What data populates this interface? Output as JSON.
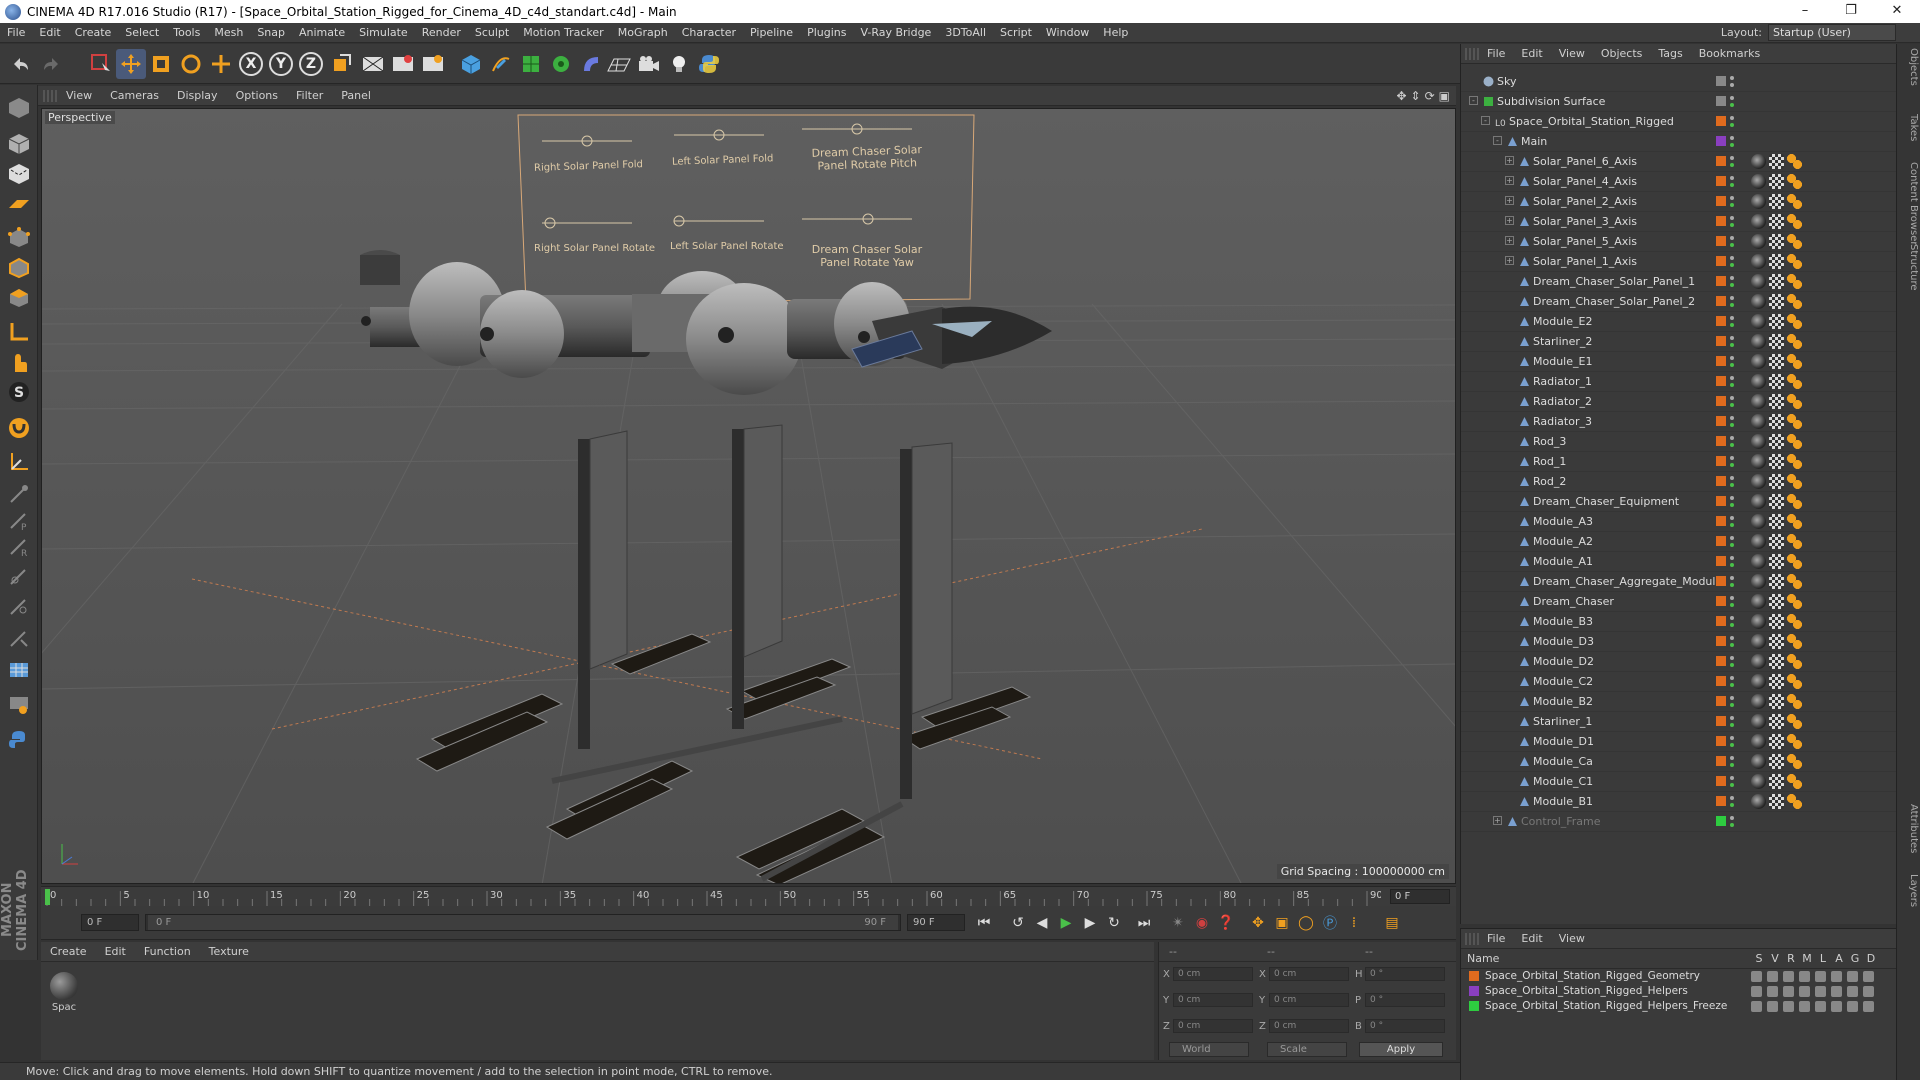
{
  "window": {
    "title": "CINEMA 4D R17.016 Studio (R17) - [Space_Orbital_Station_Rigged_for_Cinema_4D_c4d_standart.c4d] - Main",
    "controls": [
      "–",
      "❐",
      "✕"
    ]
  },
  "menu": {
    "items": [
      "File",
      "Edit",
      "Create",
      "Select",
      "Tools",
      "Mesh",
      "Snap",
      "Animate",
      "Simulate",
      "Render",
      "Sculpt",
      "Motion Tracker",
      "MoGraph",
      "Character",
      "Pipeline",
      "Plugins",
      "V-Ray Bridge",
      "3DToAll",
      "Script",
      "Window",
      "Help"
    ],
    "layout_label": "Layout:",
    "layout_value": "Startup (User)"
  },
  "toolbar": {
    "axis_x": "X",
    "axis_y": "Y",
    "axis_z": "Z",
    "icons": [
      "undo-icon",
      "redo-icon",
      "live-select-icon",
      "move-icon",
      "scale-icon",
      "rotate-icon",
      "move-multi-icon",
      "axis-x-icon",
      "axis-y-icon",
      "axis-z-icon",
      "coordinate-system-icon",
      "render-view-icon",
      "render-picture-viewer-icon",
      "render-settings-icon",
      "cube-icon",
      "pen-spline-icon",
      "subdivision-icon",
      "array-icon",
      "deformer-icon",
      "floor-icon",
      "camera-icon",
      "light-icon",
      "python-icon"
    ]
  },
  "viewport": {
    "menu": [
      "View",
      "Cameras",
      "Display",
      "Options",
      "Filter",
      "Panel"
    ],
    "label": "Perspective",
    "grid_spacing": "Grid Spacing : 100000000 cm",
    "rig_labels": [
      "Right Solar Panel Fold",
      "Left Solar Panel Fold",
      "Dream Chaser Solar Panel Rotate Pitch",
      "Right Solar Panel Rotate",
      "Left Solar Panel Rotate",
      "Dream Chaser Solar Panel Rotate Yaw"
    ]
  },
  "timeline": {
    "ticks": [
      "0",
      "5",
      "10",
      "15",
      "20",
      "25",
      "30",
      "35",
      "40",
      "45",
      "50",
      "55",
      "60",
      "65",
      "70",
      "75",
      "80",
      "85",
      "90"
    ],
    "current_frame": "0 F"
  },
  "transport": {
    "start_field": "0 F",
    "range_start": "0 F",
    "range_end": "90 F",
    "end_field": "90 F"
  },
  "materials": {
    "menu": [
      "Create",
      "Edit",
      "Function",
      "Texture"
    ],
    "items": [
      {
        "name": "Spac"
      }
    ]
  },
  "coordinates": {
    "headers": [
      "--",
      "--",
      "--"
    ],
    "rows": [
      {
        "a": "X",
        "av": "0 cm",
        "b": "X",
        "bv": "0 cm",
        "c": "H",
        "cv": "0 °"
      },
      {
        "a": "Y",
        "av": "0 cm",
        "b": "Y",
        "bv": "0 cm",
        "c": "P",
        "cv": "0 °"
      },
      {
        "a": "Z",
        "av": "0 cm",
        "b": "Z",
        "bv": "0 cm",
        "c": "B",
        "cv": "0 °"
      }
    ],
    "mode": "World",
    "transform": "Scale",
    "apply": "Apply"
  },
  "status": "Move: Click and drag to move elements. Hold down SHIFT to quantize movement / add to the selection in point mode, CTRL to remove.",
  "brand": "MAXON CINEMA 4D",
  "object_manager": {
    "menu": [
      "File",
      "Edit",
      "View",
      "Objects",
      "Tags",
      "Bookmarks"
    ],
    "rows": [
      {
        "name": "Sky",
        "indent": 0,
        "kind": "sky",
        "expand": "",
        "color": "#888888"
      },
      {
        "name": "Subdivision Surface",
        "indent": 0,
        "kind": "sds",
        "expand": "-",
        "color": "#888888"
      },
      {
        "name": "Space_Orbital_Station_Rigged",
        "indent": 1,
        "kind": "null",
        "expand": "-",
        "color": "#e06b1e"
      },
      {
        "name": "Main",
        "indent": 2,
        "kind": "joint",
        "expand": "-",
        "color": "#8a3fc0"
      },
      {
        "name": "Solar_Panel_6_Axis",
        "indent": 3,
        "kind": "joint",
        "expand": "+",
        "color": "#e06b1e"
      },
      {
        "name": "Solar_Panel_4_Axis",
        "indent": 3,
        "kind": "joint",
        "expand": "+",
        "color": "#e06b1e"
      },
      {
        "name": "Solar_Panel_2_Axis",
        "indent": 3,
        "kind": "joint",
        "expand": "+",
        "color": "#e06b1e"
      },
      {
        "name": "Solar_Panel_3_Axis",
        "indent": 3,
        "kind": "joint",
        "expand": "+",
        "color": "#e06b1e"
      },
      {
        "name": "Solar_Panel_5_Axis",
        "indent": 3,
        "kind": "joint",
        "expand": "+",
        "color": "#e06b1e"
      },
      {
        "name": "Solar_Panel_1_Axis",
        "indent": 3,
        "kind": "joint",
        "expand": "+",
        "color": "#e06b1e"
      },
      {
        "name": "Dream_Chaser_Solar_Panel_1",
        "indent": 3,
        "kind": "joint",
        "expand": "",
        "color": "#e06b1e"
      },
      {
        "name": "Dream_Chaser_Solar_Panel_2",
        "indent": 3,
        "kind": "joint",
        "expand": "",
        "color": "#e06b1e"
      },
      {
        "name": "Module_E2",
        "indent": 3,
        "kind": "joint",
        "expand": "",
        "color": "#e06b1e"
      },
      {
        "name": "Starliner_2",
        "indent": 3,
        "kind": "joint",
        "expand": "",
        "color": "#e06b1e"
      },
      {
        "name": "Module_E1",
        "indent": 3,
        "kind": "joint",
        "expand": "",
        "color": "#e06b1e"
      },
      {
        "name": "Radiator_1",
        "indent": 3,
        "kind": "joint",
        "expand": "",
        "color": "#e06b1e"
      },
      {
        "name": "Radiator_2",
        "indent": 3,
        "kind": "joint",
        "expand": "",
        "color": "#e06b1e"
      },
      {
        "name": "Radiator_3",
        "indent": 3,
        "kind": "joint",
        "expand": "",
        "color": "#e06b1e"
      },
      {
        "name": "Rod_3",
        "indent": 3,
        "kind": "joint",
        "expand": "",
        "color": "#e06b1e"
      },
      {
        "name": "Rod_1",
        "indent": 3,
        "kind": "joint",
        "expand": "",
        "color": "#e06b1e"
      },
      {
        "name": "Rod_2",
        "indent": 3,
        "kind": "joint",
        "expand": "",
        "color": "#e06b1e"
      },
      {
        "name": "Dream_Chaser_Equipment",
        "indent": 3,
        "kind": "joint",
        "expand": "",
        "color": "#e06b1e"
      },
      {
        "name": "Module_A3",
        "indent": 3,
        "kind": "joint",
        "expand": "",
        "color": "#e06b1e"
      },
      {
        "name": "Module_A2",
        "indent": 3,
        "kind": "joint",
        "expand": "",
        "color": "#e06b1e"
      },
      {
        "name": "Module_A1",
        "indent": 3,
        "kind": "joint",
        "expand": "",
        "color": "#e06b1e"
      },
      {
        "name": "Dream_Chaser_Aggregate_Module",
        "indent": 3,
        "kind": "joint",
        "expand": "",
        "color": "#e06b1e"
      },
      {
        "name": "Dream_Chaser",
        "indent": 3,
        "kind": "joint",
        "expand": "",
        "color": "#e06b1e"
      },
      {
        "name": "Module_B3",
        "indent": 3,
        "kind": "joint",
        "expand": "",
        "color": "#e06b1e"
      },
      {
        "name": "Module_D3",
        "indent": 3,
        "kind": "joint",
        "expand": "",
        "color": "#e06b1e"
      },
      {
        "name": "Module_D2",
        "indent": 3,
        "kind": "joint",
        "expand": "",
        "color": "#e06b1e"
      },
      {
        "name": "Module_C2",
        "indent": 3,
        "kind": "joint",
        "expand": "",
        "color": "#e06b1e"
      },
      {
        "name": "Module_B2",
        "indent": 3,
        "kind": "joint",
        "expand": "",
        "color": "#e06b1e"
      },
      {
        "name": "Starliner_1",
        "indent": 3,
        "kind": "joint",
        "expand": "",
        "color": "#e06b1e"
      },
      {
        "name": "Module_D1",
        "indent": 3,
        "kind": "joint",
        "expand": "",
        "color": "#e06b1e"
      },
      {
        "name": "Module_Ca",
        "indent": 3,
        "kind": "joint",
        "expand": "",
        "color": "#e06b1e"
      },
      {
        "name": "Module_C1",
        "indent": 3,
        "kind": "joint",
        "expand": "",
        "color": "#e06b1e"
      },
      {
        "name": "Module_B1",
        "indent": 3,
        "kind": "joint",
        "expand": "",
        "color": "#e06b1e"
      },
      {
        "name": "Control_Frame",
        "indent": 2,
        "kind": "joint",
        "expand": "+",
        "color": "#2ecc40",
        "dim": true
      }
    ]
  },
  "layer_manager": {
    "menu": [
      "File",
      "Edit",
      "View"
    ],
    "header": "Name",
    "columns": [
      "S",
      "V",
      "R",
      "M",
      "L",
      "A",
      "G",
      "D"
    ],
    "layers": [
      {
        "name": "Space_Orbital_Station_Rigged_Geometry",
        "color": "#e06b1e"
      },
      {
        "name": "Space_Orbital_Station_Rigged_Helpers",
        "color": "#8a3fc0"
      },
      {
        "name": "Space_Orbital_Station_Rigged_Helpers_Freeze",
        "color": "#2ecc40"
      }
    ]
  },
  "side_tabs": [
    "Objects",
    "Takes",
    "Content Browser",
    "Structure",
    "Attributes",
    "Layers"
  ]
}
